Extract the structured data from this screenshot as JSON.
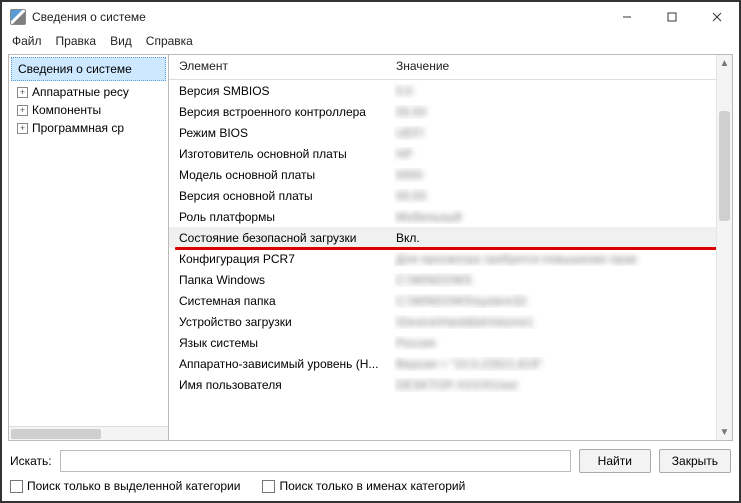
{
  "window": {
    "title": "Сведения о системе"
  },
  "menu": {
    "file": "Файл",
    "edit": "Правка",
    "view": "Вид",
    "help": "Справка"
  },
  "tree": {
    "root": "Сведения о системе",
    "items": [
      {
        "label": "Аппаратные ресу"
      },
      {
        "label": "Компоненты"
      },
      {
        "label": "Программная ср"
      }
    ]
  },
  "columns": {
    "element": "Элемент",
    "value": "Значение"
  },
  "rows": [
    {
      "el": "Версия SMBIOS",
      "val": "0.0",
      "blur": true
    },
    {
      "el": "Версия встроенного контроллера",
      "val": "00.00",
      "blur": true
    },
    {
      "el": "Режим BIOS",
      "val": "UEFI",
      "blur": true
    },
    {
      "el": "Изготовитель основной платы",
      "val": "HP",
      "blur": true
    },
    {
      "el": "Модель основной платы",
      "val": "0000",
      "blur": true
    },
    {
      "el": "Версия основной платы",
      "val": "00.00",
      "blur": true
    },
    {
      "el": "Роль платформы",
      "val": "Мобильный",
      "blur": true
    },
    {
      "el": "Состояние безопасной загрузки",
      "val": "Вкл.",
      "blur": false,
      "highlight": true
    },
    {
      "el": "Конфигурация PCR7",
      "val": "Для просмотра требуется повышение прав",
      "blur": true
    },
    {
      "el": "Папка Windows",
      "val": "C:\\WINDOWS",
      "blur": true
    },
    {
      "el": "Системная папка",
      "val": "C:\\WINDOWS\\system32",
      "blur": true
    },
    {
      "el": "Устройство загрузки",
      "val": "\\Device\\HarddiskVolume1",
      "blur": true
    },
    {
      "el": "Язык системы",
      "val": "Россия",
      "blur": true
    },
    {
      "el": "Аппаратно-зависимый уровень (H...",
      "val": "Версия = \"10.0.22621.819\"",
      "blur": true
    },
    {
      "el": "Имя пользователя",
      "val": "DESKTOP-XXXX\\User",
      "blur": true
    }
  ],
  "search": {
    "label": "Искать:",
    "placeholder": "",
    "find": "Найти",
    "close": "Закрыть"
  },
  "checks": {
    "selected_only": "Поиск только в выделенной категории",
    "names_only": "Поиск только в именах категорий"
  }
}
